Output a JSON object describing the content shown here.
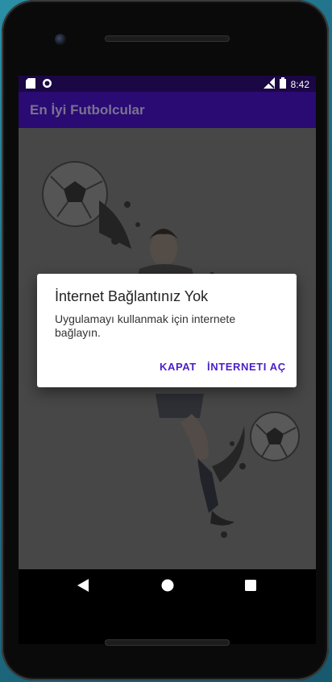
{
  "status_bar": {
    "time": "8:42"
  },
  "app_bar": {
    "title": "En İyi Futbolcular"
  },
  "dialog": {
    "title": "İnternet Bağlantınız Yok",
    "message": "Uygulamayı kullanmak için internete bağlayın.",
    "buttons": {
      "close": "KAPAT",
      "open_internet": "İNTERNETI AÇ"
    }
  },
  "colors": {
    "status_bar": "#1a0744",
    "app_bar": "#2a0a73",
    "dialog_button": "#4a1fc7",
    "content_background": "#595959"
  }
}
